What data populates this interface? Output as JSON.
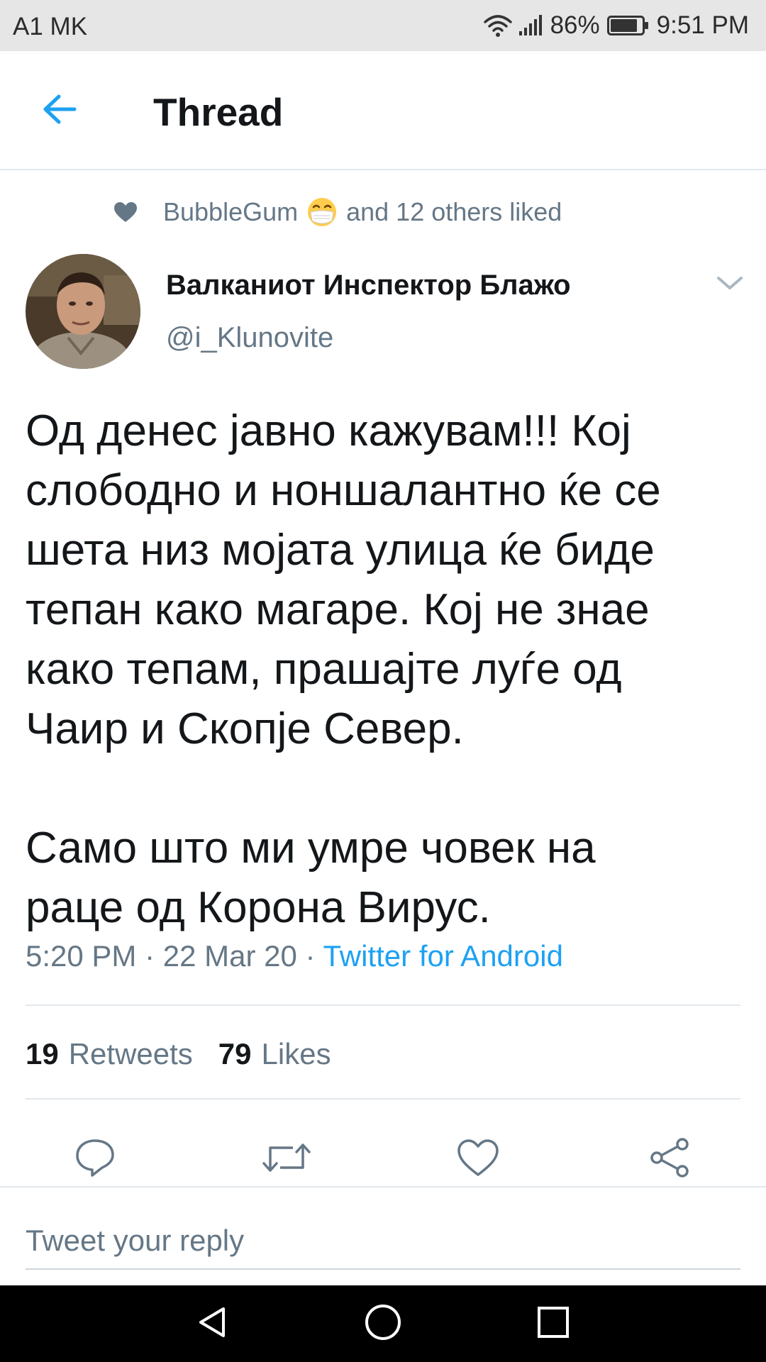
{
  "status_bar": {
    "carrier": "A1 MK",
    "battery": "86%",
    "time": "9:51 PM",
    "battery_level": 0.86,
    "icons": [
      "wifi-icon",
      "signal-icon",
      "battery-icon"
    ]
  },
  "header": {
    "title": "Thread",
    "back_icon": "arrow-left-icon"
  },
  "social_context": {
    "user": "BubbleGum",
    "emoji": "face-with-medical-mask",
    "text": "and 12 others liked"
  },
  "tweet": {
    "author_name": "Валканиот Инспектор Блажо",
    "author_handle": "@i_Klunovite",
    "text_lines_1": [
      "Од денес јавно кажувам!!! Кој",
      "слободно и ноншалантно ќе се",
      "шета низ мојата улица ќе биде",
      "тепан како магаре. Кој не знае",
      "како тепам, прашајте луѓе од",
      "Чаир и Скопје Север."
    ],
    "text_lines_2": [
      "Само што ми умре човек на",
      "раце од Корона Вирус."
    ],
    "time": "5:20 PM",
    "date": "22 Mar 20",
    "separator": "·",
    "source": "Twitter for Android",
    "retweets_count": "19",
    "retweets_label": "Retweets",
    "likes_count": "79",
    "likes_label": "Likes"
  },
  "actions": [
    "reply-icon",
    "retweet-icon",
    "like-icon",
    "share-icon"
  ],
  "reply": {
    "placeholder": "Tweet your reply"
  },
  "nav": [
    "back-triangle-icon",
    "home-circle-icon",
    "recents-square-icon"
  ],
  "colors": {
    "accent": "#1da1f2",
    "secondary_text": "#657786",
    "primary_text": "#14171a",
    "divider": "#e1e8ed",
    "status_bar": "#e6e6e6"
  }
}
